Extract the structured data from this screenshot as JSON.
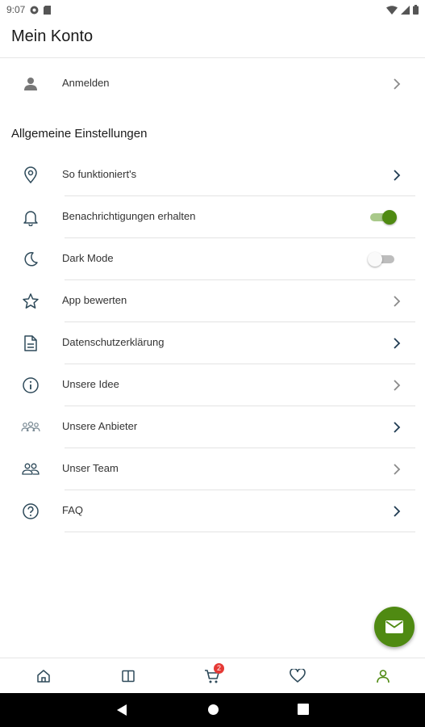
{
  "status_bar": {
    "time": "9:07"
  },
  "header": {
    "title": "Mein Konto"
  },
  "login": {
    "label": "Anmelden"
  },
  "section": {
    "title": "Allgemeine Einstellungen"
  },
  "settings": {
    "items": [
      {
        "label": "So funktioniert's",
        "icon": "location-pin-icon"
      },
      {
        "label": "Benachrichtigungen erhalten",
        "icon": "bell-icon",
        "toggle": true,
        "on": true
      },
      {
        "label": "Dark Mode",
        "icon": "moon-icon",
        "toggle": true,
        "on": false
      },
      {
        "label": "App bewerten",
        "icon": "star-icon"
      },
      {
        "label": "Datenschutzerklärung",
        "icon": "document-icon"
      },
      {
        "label": "Unsere Idee",
        "icon": "info-icon"
      },
      {
        "label": "Unsere Anbieter",
        "icon": "providers-group-icon"
      },
      {
        "label": "Unser Team",
        "icon": "team-icon"
      },
      {
        "label": "FAQ",
        "icon": "help-circle-icon"
      }
    ]
  },
  "bottom_nav": {
    "cart_badge": "2",
    "items": [
      "home-icon",
      "catalog-icon",
      "cart-icon",
      "favorites-icon",
      "account-icon"
    ],
    "active": "account-icon"
  },
  "colors": {
    "accent": "#4f8a12",
    "icon": "#2e4a5a",
    "chevron_dark": "#1f3b52",
    "chevron_light": "#8a8a8a",
    "badge": "#e53935"
  }
}
